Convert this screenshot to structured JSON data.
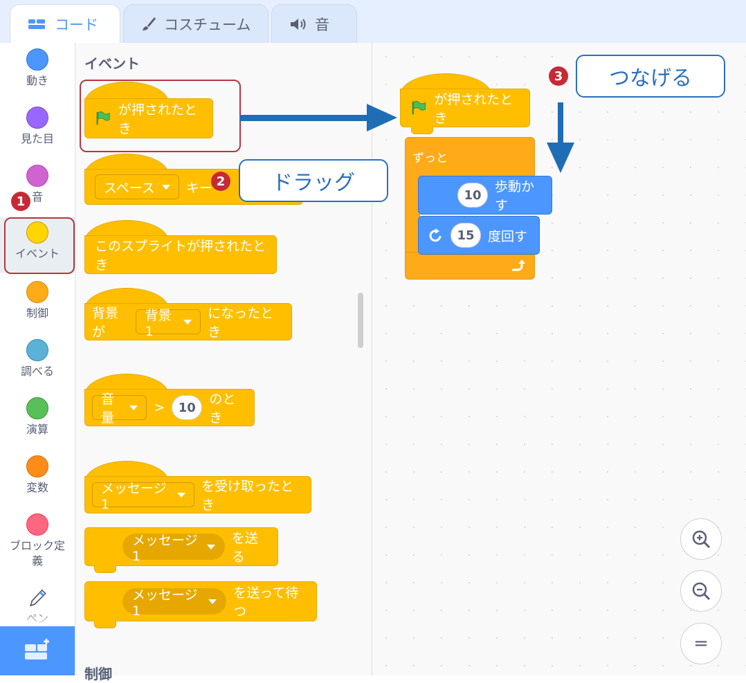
{
  "tabs": [
    {
      "label": "コード",
      "icon": "code-icon",
      "active": true
    },
    {
      "label": "コスチューム",
      "icon": "brush-icon",
      "active": false
    },
    {
      "label": "音",
      "icon": "speaker-icon",
      "active": false
    }
  ],
  "categories": [
    {
      "label": "動き",
      "color": "#4c97ff"
    },
    {
      "label": "見た目",
      "color": "#9966ff"
    },
    {
      "label": "音",
      "color": "#cf63cf"
    },
    {
      "label": "イベント",
      "color": "#ffd500"
    },
    {
      "label": "制御",
      "color": "#ffab19"
    },
    {
      "label": "調べる",
      "color": "#5cb1d6"
    },
    {
      "label": "演算",
      "color": "#59c059"
    },
    {
      "label": "変数",
      "color": "#ff8c1a"
    },
    {
      "label": "ブロック定義",
      "color": "#ff6680"
    },
    {
      "label": "ペン",
      "icon": "pen-icon"
    }
  ],
  "palette": {
    "section_title": "イベント",
    "next_section_title": "制御",
    "blocks": {
      "when_flag_clicked": "が押されたとき",
      "when_key_pressed": {
        "key": "スペース",
        "text_visible": "キー"
      },
      "when_sprite_clicked": "このスプライトが押されたとき",
      "when_backdrop": {
        "prefix": "背景が",
        "value": "背景1",
        "suffix": "になったとき"
      },
      "when_greater": {
        "value": "音量",
        "op": ">",
        "num": "10",
        "suffix": "のとき"
      },
      "when_receive": {
        "value": "メッセージ1",
        "suffix": "を受け取ったとき"
      },
      "broadcast": {
        "value": "メッセージ1",
        "suffix": "を送る"
      },
      "broadcast_wait": {
        "value": "メッセージ1",
        "suffix": "を送って待つ"
      }
    }
  },
  "script": {
    "hat": "が押されたとき",
    "forever": "ずっと",
    "move": {
      "num": "10",
      "label": "歩動かす"
    },
    "turn": {
      "num": "15",
      "label": "度回す"
    }
  },
  "annotations": {
    "step1": "1",
    "step2": "2",
    "step3": "3",
    "drag": "ドラッグ",
    "connect": "つなげる"
  },
  "zoom": {
    "in": "+",
    "out": "−",
    "reset": "="
  },
  "colors": {
    "events": "#ffbf00",
    "control": "#ffab19",
    "motion": "#4c97ff",
    "annotation_blue": "#2a6fbd",
    "annotation_red": "#b7343e"
  }
}
